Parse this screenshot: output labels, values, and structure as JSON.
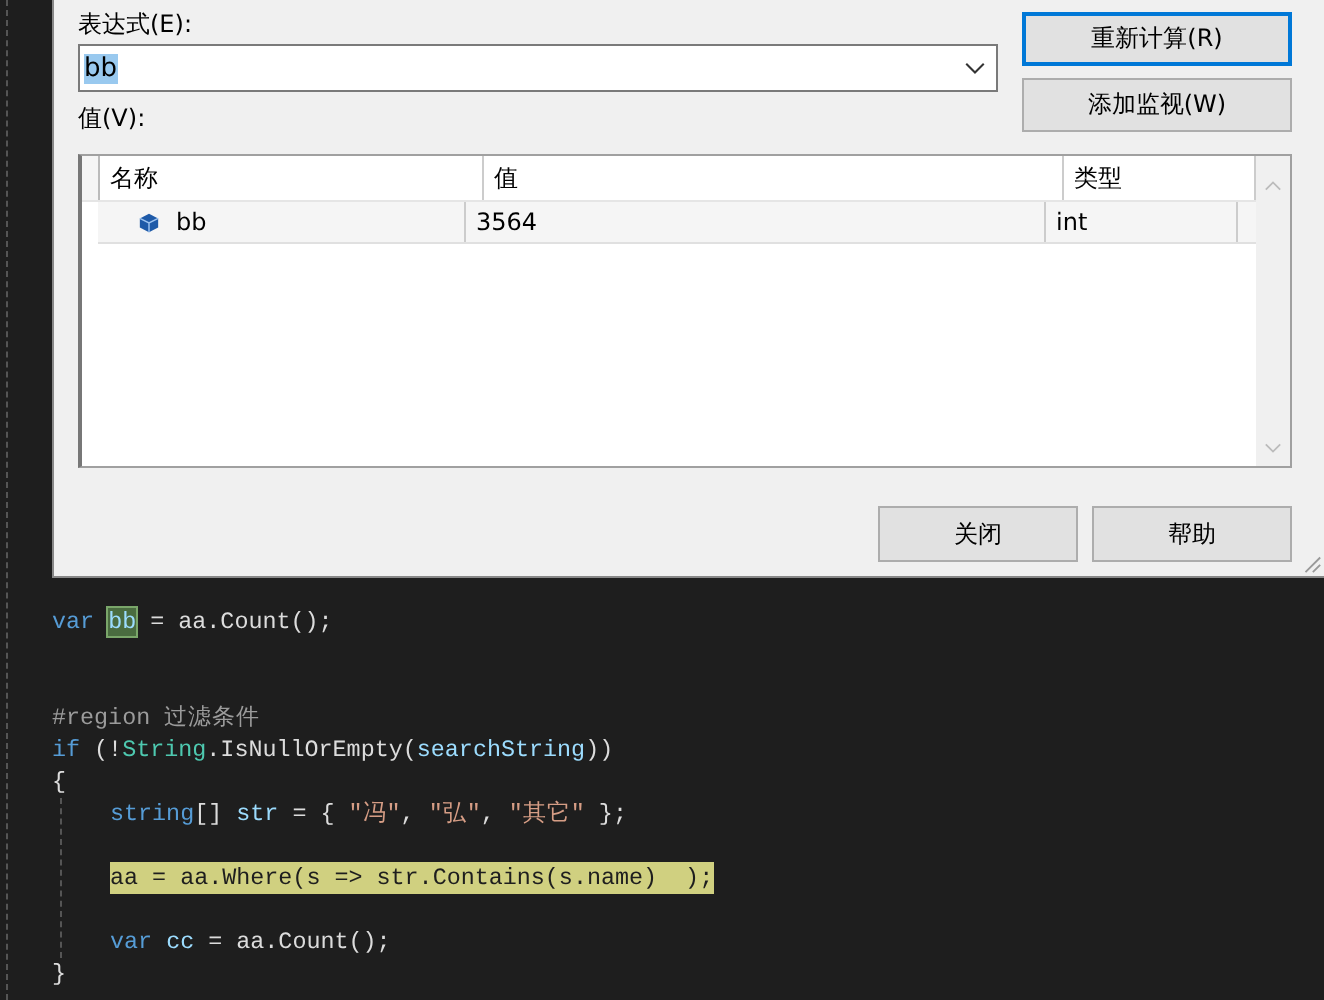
{
  "dialog": {
    "expression_label": "表达式(E):",
    "expression": {
      "value": "bb",
      "selected": true
    },
    "value_label": "值(V):",
    "side_buttons": [
      {
        "label": "重新计算(R)",
        "focused": true
      },
      {
        "label": "添加监视(W)",
        "focused": false
      }
    ],
    "grid": {
      "columns": [
        "名称",
        "值",
        "类型"
      ],
      "rows": [
        {
          "name": "bb",
          "value": "3564",
          "type": "int"
        }
      ]
    },
    "bottom_buttons": [
      "关闭",
      "帮助"
    ]
  },
  "editor": {
    "lines": [
      {
        "kind": "code",
        "current": false,
        "tokens": [
          {
            "kind": "keyword",
            "text": "var "
          },
          {
            "kind": "match",
            "text": "bb"
          },
          {
            "kind": "plain",
            "text": " = aa.Count();"
          }
        ]
      },
      {
        "kind": "blank"
      },
      {
        "kind": "blank"
      },
      {
        "kind": "code",
        "current": false,
        "tokens": [
          {
            "kind": "directive",
            "text": "#region 过滤条件"
          }
        ]
      },
      {
        "kind": "code",
        "current": false,
        "tokens": [
          {
            "kind": "keyword",
            "text": "if"
          },
          {
            "kind": "plain",
            "text": " (!"
          },
          {
            "kind": "type",
            "text": "String"
          },
          {
            "kind": "plain",
            "text": ".IsNullOrEmpty("
          },
          {
            "kind": "ident",
            "text": "searchString"
          },
          {
            "kind": "plain",
            "text": "))"
          }
        ]
      },
      {
        "kind": "code",
        "current": false,
        "tokens": [
          {
            "kind": "plain",
            "text": "{"
          }
        ],
        "children": [
          {
            "kind": "code",
            "current": false,
            "tokens": [
              {
                "kind": "keyword",
                "text": "string"
              },
              {
                "kind": "plain",
                "text": "[] "
              },
              {
                "kind": "ident",
                "text": "str"
              },
              {
                "kind": "plain",
                "text": " = { "
              },
              {
                "kind": "string",
                "text": "\"冯\""
              },
              {
                "kind": "plain",
                "text": ", "
              },
              {
                "kind": "string",
                "text": "\"弘\""
              },
              {
                "kind": "plain",
                "text": ", "
              },
              {
                "kind": "string",
                "text": "\"其它\""
              },
              {
                "kind": "plain",
                "text": " };"
              }
            ]
          },
          {
            "kind": "blank"
          },
          {
            "kind": "code",
            "current": true,
            "tokens": [
              {
                "kind": "plain",
                "text": "aa = aa.Where(s => str.Contains(s.name)  );"
              }
            ]
          },
          {
            "kind": "blank"
          },
          {
            "kind": "code",
            "current": false,
            "tokens": [
              {
                "kind": "keyword",
                "text": "var "
              },
              {
                "kind": "ident",
                "text": "cc"
              },
              {
                "kind": "plain",
                "text": " = aa.Count();"
              }
            ]
          }
        ]
      },
      {
        "kind": "code",
        "current": false,
        "tokens": [
          {
            "kind": "plain",
            "text": "}"
          }
        ]
      }
    ]
  }
}
